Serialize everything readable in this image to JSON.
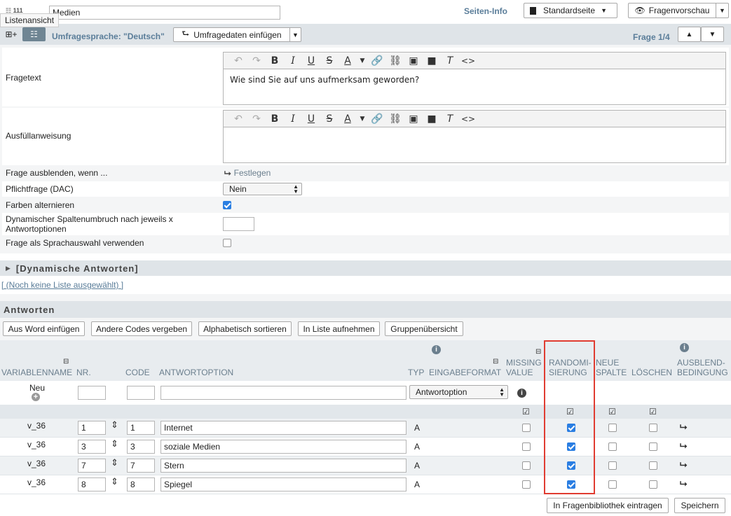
{
  "header": {
    "question_number": "111",
    "title_value": "Medien",
    "tooltip": "Listenansicht",
    "page_info_link": "Seiten-Info",
    "page_type": "Standardseite",
    "preview_button": "Fragenvorschau"
  },
  "subheader": {
    "language_label": "Umfragesprache: \"Deutsch\"",
    "insert_data_button": "Umfragedaten einfügen",
    "question_counter": "Frage 1/4"
  },
  "form": {
    "question_text_label": "Fragetext",
    "question_text_value": "Wie sind Sie auf uns aufmerksam geworden?",
    "instruction_label": "Ausfüllanweisung",
    "instruction_value": "",
    "hide_label": "Frage ausblenden, wenn ...",
    "hide_action": "Festlegen",
    "mandatory_label": "Pflichtfrage (DAC)",
    "mandatory_value": "Nein",
    "alternate_colors_label": "Farben alternieren",
    "alternate_colors_checked": true,
    "column_break_label_line1": "Dynamischer Spaltenumbruch nach jeweils x",
    "column_break_label_line2": "Antwortoptionen",
    "column_break_value": "",
    "language_select_label": "Frage als Sprachauswahl verwenden",
    "language_select_checked": false
  },
  "dynamic_answers": {
    "title": "[Dynamische Antworten]",
    "no_list_link": "[ (Noch keine Liste ausgewählt) ]"
  },
  "answers": {
    "title": "Antworten",
    "buttons": [
      "Aus Word einfügen",
      "Andere Codes vergeben",
      "Alphabetisch sortieren",
      "In Liste aufnehmen",
      "Gruppenübersicht"
    ],
    "columns": {
      "varname": "VARIABLENNAME",
      "nr": "NR.",
      "code": "CODE",
      "option": "ANTWORTOPTION",
      "type": "TYP",
      "input_format": "EINGABEFORMAT",
      "missing_1": "MISSING",
      "missing_2": "VALUE",
      "random_1": "RANDOMI-",
      "random_2": "SIERUNG",
      "newcol_1": "NEUE",
      "newcol_2": "SPALTE",
      "delete": "LÖSCHEN",
      "cond_1": "AUSBLEND-",
      "cond_2": "BEDINGUNG"
    },
    "new_row": {
      "label": "Neu",
      "format_value": "Antwortoption"
    },
    "rows": [
      {
        "var": "v_36",
        "nr": "1",
        "code": "1",
        "option": "Internet",
        "type": "A",
        "missing": false,
        "random": true,
        "newcol": false,
        "delete": false
      },
      {
        "var": "v_36",
        "nr": "3",
        "code": "3",
        "option": "soziale Medien",
        "type": "A",
        "missing": false,
        "random": true,
        "newcol": false,
        "delete": false
      },
      {
        "var": "v_36",
        "nr": "7",
        "code": "7",
        "option": "Stern",
        "type": "A",
        "missing": false,
        "random": true,
        "newcol": false,
        "delete": false
      },
      {
        "var": "v_36",
        "nr": "8",
        "code": "8",
        "option": "Spiegel",
        "type": "A",
        "missing": false,
        "random": true,
        "newcol": false,
        "delete": false
      }
    ]
  },
  "footer": {
    "library_button": "In Fragenbibliothek eintragen",
    "save_button": "Speichern"
  },
  "colors": {
    "accent": "#2a7ee2",
    "header_bar": "#dfe4e8",
    "label_blue": "#5a7d99",
    "highlight_red": "#e03c31"
  }
}
